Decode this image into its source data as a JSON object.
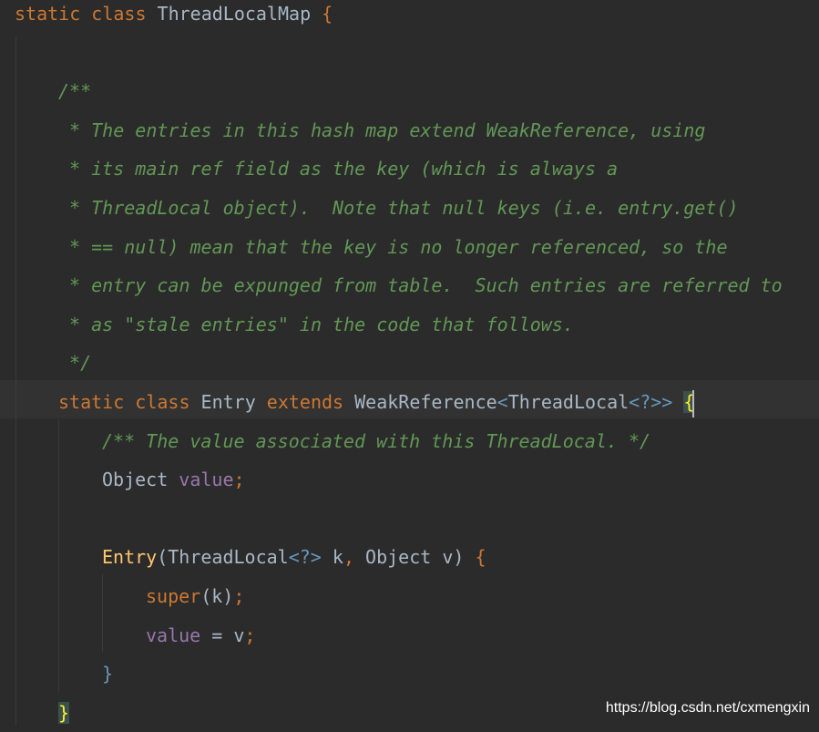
{
  "editor": {
    "theme_colors": {
      "background": "#2b2b2b",
      "keyword": "#cc7832",
      "comment": "#629755",
      "field": "#9876aa",
      "method": "#ffc66d",
      "text": "#a9b7c6"
    },
    "current_line": 10,
    "lines": [
      {
        "indent": 0,
        "tokens": [
          [
            "static class ",
            "kw"
          ],
          [
            "ThreadLocalMap ",
            "cl"
          ],
          [
            "{",
            "pn"
          ]
        ]
      },
      {
        "indent": 0,
        "tokens": []
      },
      {
        "indent": 4,
        "tokens": [
          [
            "/**",
            "cm"
          ]
        ]
      },
      {
        "indent": 4,
        "tokens": [
          [
            " * The entries in this hash map extend WeakReference, using",
            "cm"
          ]
        ]
      },
      {
        "indent": 4,
        "tokens": [
          [
            " * its main ref field as the key (which is always a",
            "cm"
          ]
        ]
      },
      {
        "indent": 4,
        "tokens": [
          [
            " * ThreadLocal object).  Note that null keys (i.e. entry.get()",
            "cm"
          ]
        ]
      },
      {
        "indent": 4,
        "tokens": [
          [
            " * == null) mean that the key is no longer referenced, so the",
            "cm"
          ]
        ]
      },
      {
        "indent": 4,
        "tokens": [
          [
            " * entry can be expunged from table.  Such entries are referred to",
            "cm"
          ]
        ]
      },
      {
        "indent": 4,
        "tokens": [
          [
            " * as \"stale entries\" in the code that follows.",
            "cm"
          ]
        ]
      },
      {
        "indent": 4,
        "tokens": [
          [
            " */",
            "cm"
          ]
        ]
      },
      {
        "indent": 4,
        "tokens": [
          [
            "static class ",
            "kw"
          ],
          [
            "Entry ",
            "cl"
          ],
          [
            "extends ",
            "kw"
          ],
          [
            "WeakReference",
            "cl"
          ],
          [
            "<",
            "br"
          ],
          [
            "ThreadLocal",
            "cl"
          ],
          [
            "<?>> ",
            "br"
          ],
          [
            "{",
            "match"
          ]
        ]
      },
      {
        "indent": 8,
        "tokens": [
          [
            "/** The value associated with this ThreadLocal. */",
            "cm"
          ]
        ]
      },
      {
        "indent": 8,
        "tokens": [
          [
            "Object ",
            "cl"
          ],
          [
            "value",
            "fd"
          ],
          [
            ";",
            "pn"
          ]
        ]
      },
      {
        "indent": 8,
        "tokens": []
      },
      {
        "indent": 8,
        "tokens": [
          [
            "Entry",
            "md"
          ],
          [
            "(ThreadLocal",
            "cl"
          ],
          [
            "<?> ",
            "br"
          ],
          [
            "k",
            "cl"
          ],
          [
            ", ",
            "pn"
          ],
          [
            "Object v) ",
            "cl"
          ],
          [
            "{",
            "pn"
          ]
        ]
      },
      {
        "indent": 12,
        "tokens": [
          [
            "super",
            "kw"
          ],
          [
            "(k)",
            "cl"
          ],
          [
            ";",
            "pn"
          ]
        ]
      },
      {
        "indent": 12,
        "tokens": [
          [
            "value",
            "fd"
          ],
          [
            " = v",
            "cl"
          ],
          [
            ";",
            "pn"
          ]
        ]
      },
      {
        "indent": 8,
        "tokens": [
          [
            "}",
            "br"
          ]
        ]
      },
      {
        "indent": 4,
        "tokens": [
          [
            "}",
            "match"
          ]
        ]
      }
    ]
  },
  "watermark": "https://blog.csdn.net/cxmengxin"
}
